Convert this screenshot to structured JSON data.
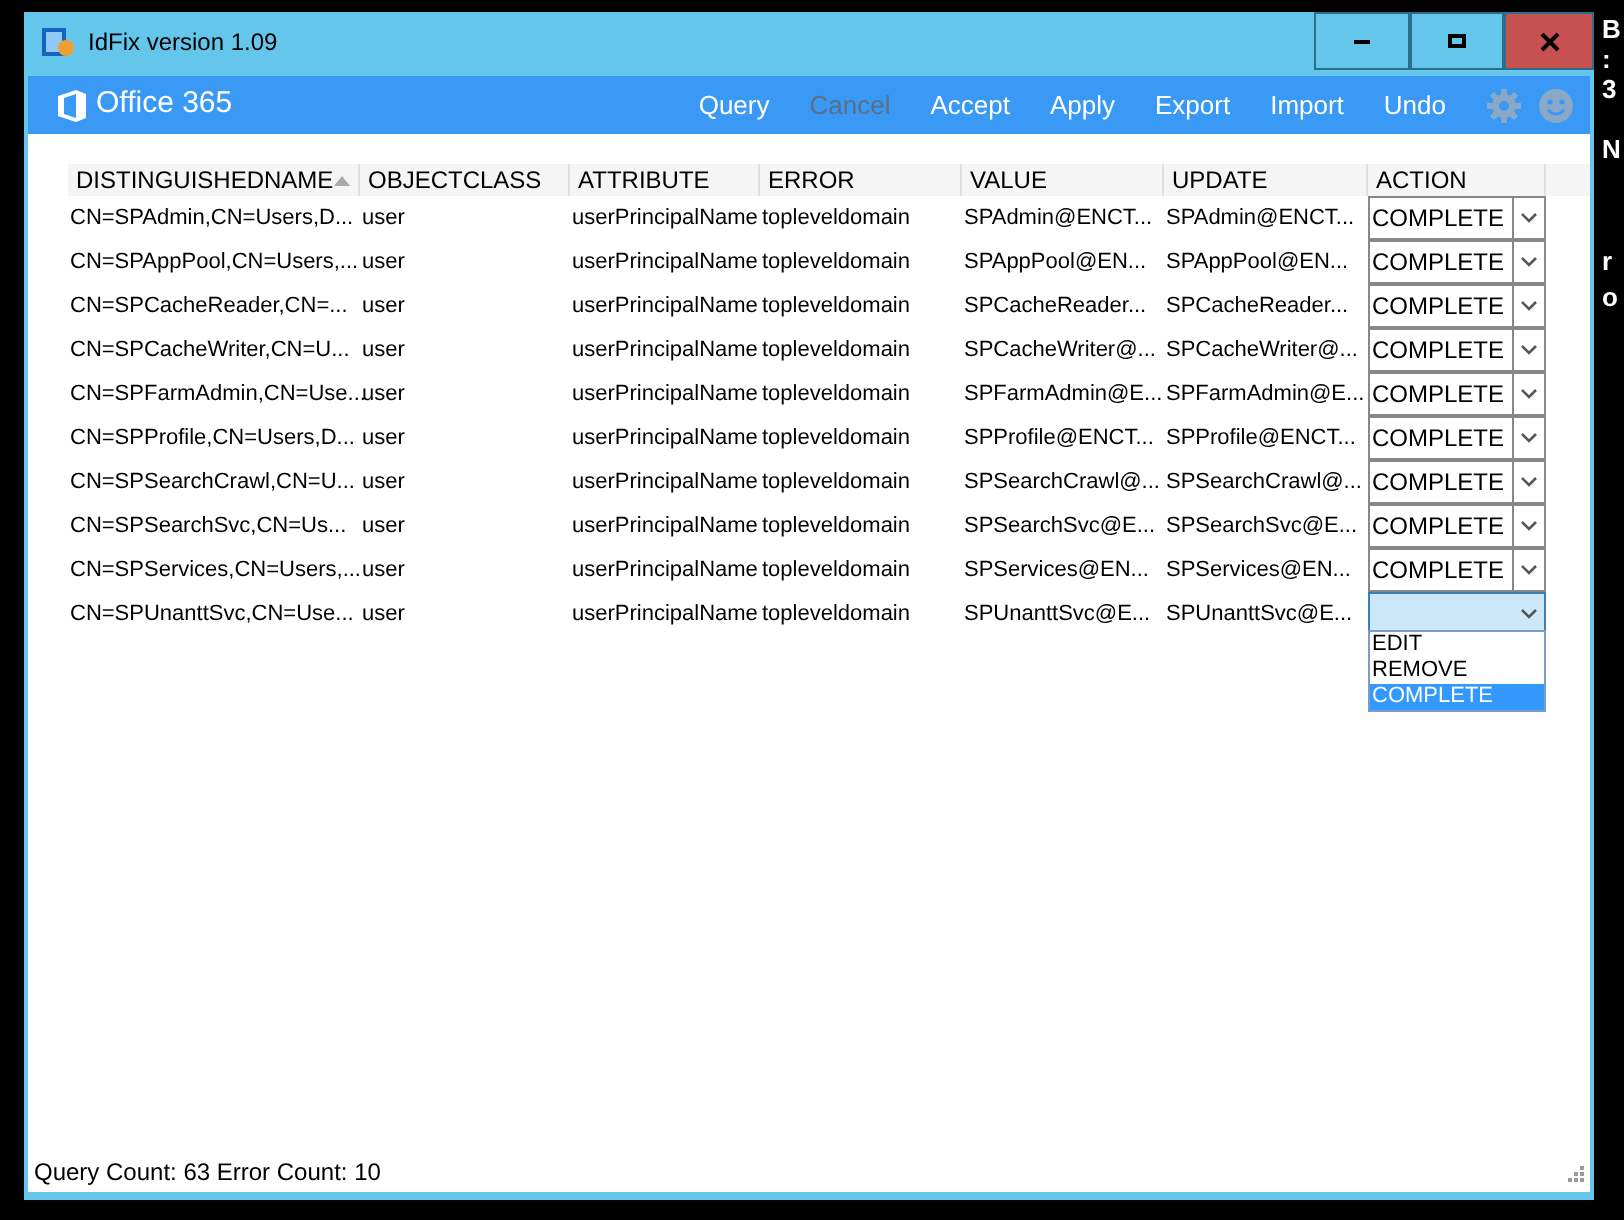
{
  "desktop": {
    "edge_fragments": [
      "B",
      ":",
      "3",
      "N",
      "r",
      "o"
    ]
  },
  "window": {
    "title": "IdFix version 1.09"
  },
  "toolbar": {
    "brand": "Office 365",
    "buttons": [
      {
        "label": "Query",
        "disabled": false
      },
      {
        "label": "Cancel",
        "disabled": true
      },
      {
        "label": "Accept",
        "disabled": false
      },
      {
        "label": "Apply",
        "disabled": false
      },
      {
        "label": "Export",
        "disabled": false
      },
      {
        "label": "Import",
        "disabled": false
      },
      {
        "label": "Undo",
        "disabled": false
      }
    ]
  },
  "table": {
    "columns": [
      {
        "label": "DISTINGUISHEDNAME",
        "sorted": true
      },
      {
        "label": "OBJECTCLASS",
        "sorted": false
      },
      {
        "label": "ATTRIBUTE",
        "sorted": false
      },
      {
        "label": "ERROR",
        "sorted": false
      },
      {
        "label": "VALUE",
        "sorted": false
      },
      {
        "label": "UPDATE",
        "sorted": false
      },
      {
        "label": "ACTION",
        "sorted": false
      }
    ],
    "rows": [
      {
        "cells": [
          "CN=SPAdmin,CN=Users,D...",
          "user",
          "userPrincipalName",
          "topleveldomain",
          "SPAdmin@ENCT...",
          "SPAdmin@ENCT..."
        ],
        "action": "COMPLETE",
        "selected": false
      },
      {
        "cells": [
          "CN=SPAppPool,CN=Users,...",
          "user",
          "userPrincipalName",
          "topleveldomain",
          "SPAppPool@EN...",
          "SPAppPool@EN..."
        ],
        "action": "COMPLETE",
        "selected": false
      },
      {
        "cells": [
          "CN=SPCacheReader,CN=...",
          "user",
          "userPrincipalName",
          "topleveldomain",
          "SPCacheReader...",
          "SPCacheReader..."
        ],
        "action": "COMPLETE",
        "selected": false
      },
      {
        "cells": [
          "CN=SPCacheWriter,CN=U...",
          "user",
          "userPrincipalName",
          "topleveldomain",
          "SPCacheWriter@...",
          "SPCacheWriter@..."
        ],
        "action": "COMPLETE",
        "selected": false
      },
      {
        "cells": [
          "CN=SPFarmAdmin,CN=Use...",
          "user",
          "userPrincipalName",
          "topleveldomain",
          "SPFarmAdmin@E...",
          "SPFarmAdmin@E..."
        ],
        "action": "COMPLETE",
        "selected": false
      },
      {
        "cells": [
          "CN=SPProfile,CN=Users,D...",
          "user",
          "userPrincipalName",
          "topleveldomain",
          "SPProfile@ENCT...",
          "SPProfile@ENCT..."
        ],
        "action": "COMPLETE",
        "selected": false
      },
      {
        "cells": [
          "CN=SPSearchCrawl,CN=U...",
          "user",
          "userPrincipalName",
          "topleveldomain",
          "SPSearchCrawl@...",
          "SPSearchCrawl@..."
        ],
        "action": "COMPLETE",
        "selected": false
      },
      {
        "cells": [
          "CN=SPSearchSvc,CN=Us...",
          "user",
          "userPrincipalName",
          "topleveldomain",
          "SPSearchSvc@E...",
          "SPSearchSvc@E..."
        ],
        "action": "COMPLETE",
        "selected": false
      },
      {
        "cells": [
          "CN=SPServices,CN=Users,...",
          "user",
          "userPrincipalName",
          "topleveldomain",
          "SPServices@EN...",
          "SPServices@EN..."
        ],
        "action": "COMPLETE",
        "selected": false
      },
      {
        "cells": [
          "CN=SPUnanttSvc,CN=Use...",
          "user",
          "userPrincipalName",
          "topleveldomain",
          "SPUnanttSvc@E...",
          "SPUnanttSvc@E..."
        ],
        "selected": true,
        "expanded": true
      }
    ]
  },
  "dropdown": {
    "options": [
      {
        "label": "EDIT",
        "selected": false
      },
      {
        "label": "REMOVE",
        "selected": false
      },
      {
        "label": "COMPLETE",
        "selected": true
      }
    ]
  },
  "status_bar": {
    "text": "Query Count: 63  Error Count: 10"
  }
}
